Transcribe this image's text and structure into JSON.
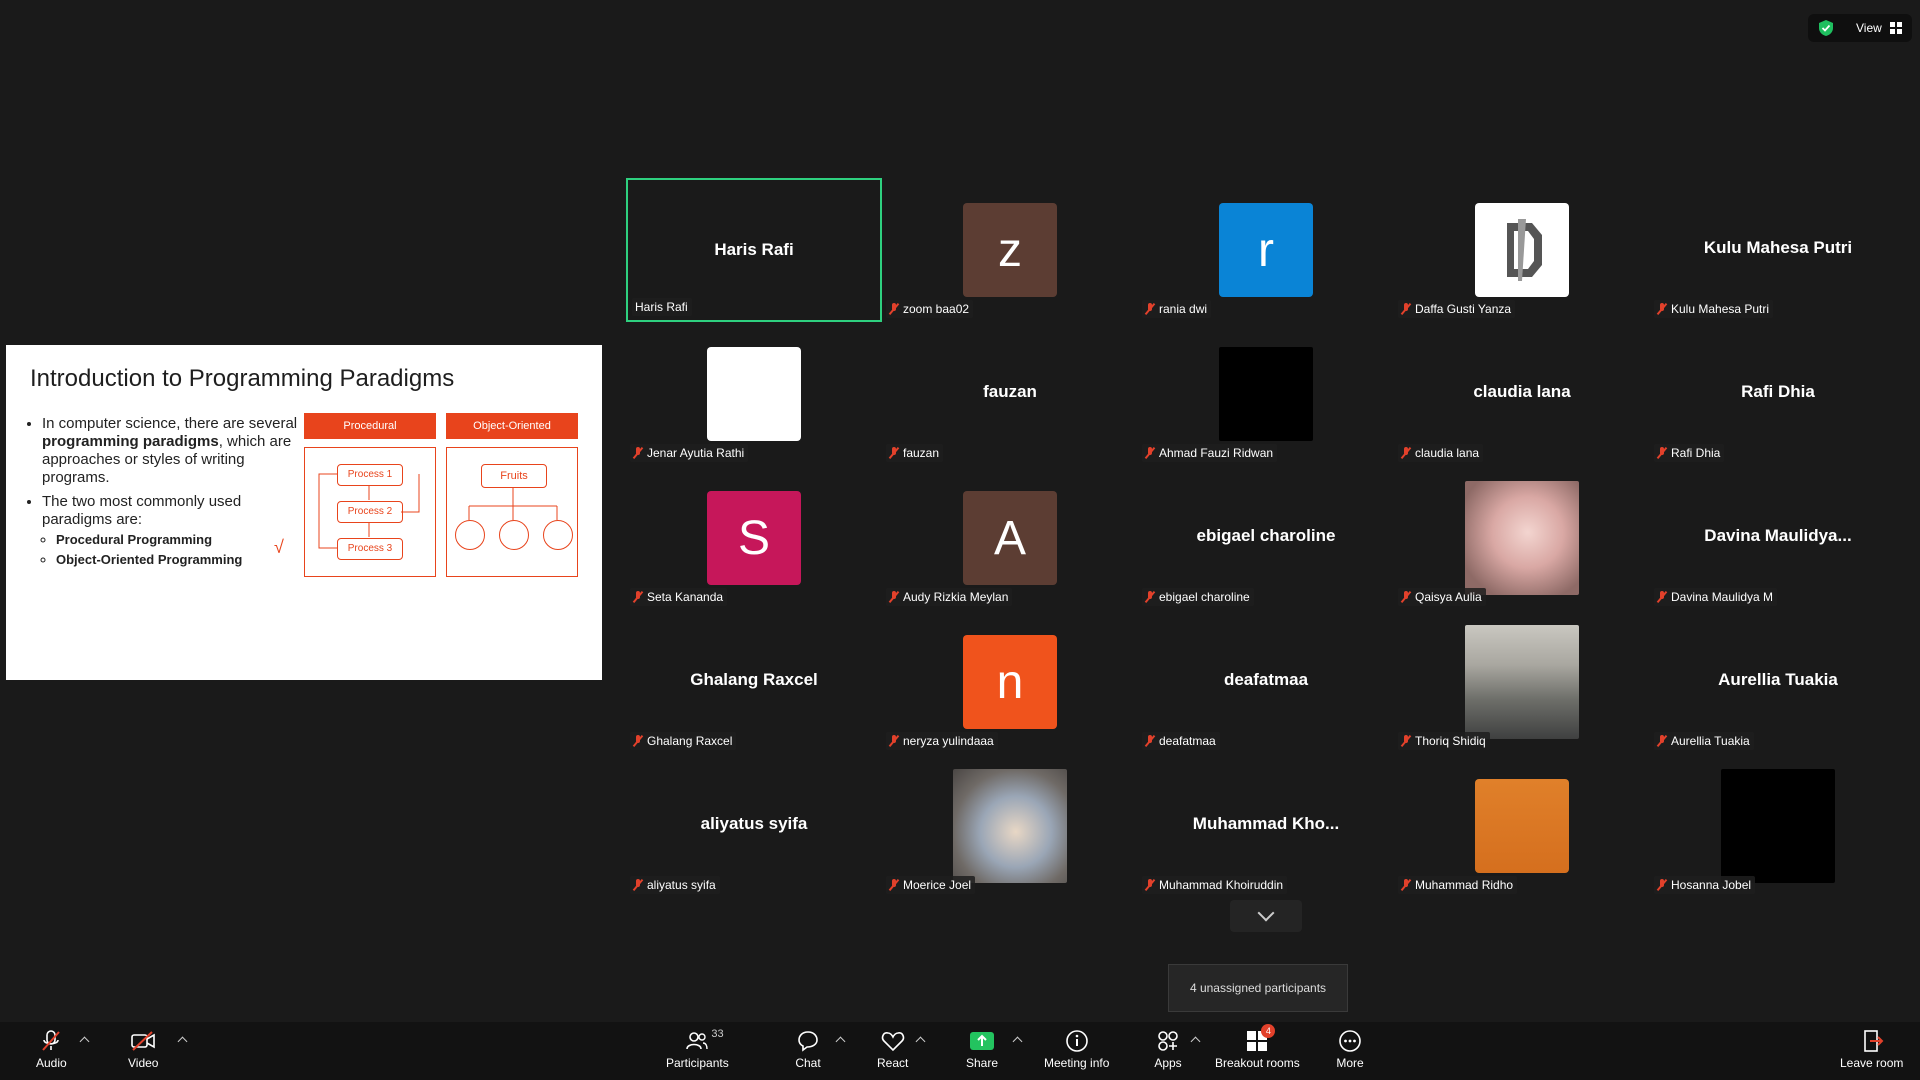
{
  "top_bar": {
    "view_label": "View",
    "shield_color": "#1fbf5f"
  },
  "slide": {
    "title": "Introduction to Programming Paradigms",
    "bullet1_pre": "In computer science, there are several ",
    "bullet1_bold": "programming paradigms",
    "bullet1_post": ", which are approaches or styles of writing programs.",
    "bullet2": "The two most commonly used paradigms are:",
    "sub1": "Procedural Programming",
    "sub2": "Object-Oriented Programming",
    "diagram_left_title": "Procedural",
    "diagram_right_title": "Object-Oriented",
    "process1": "Process 1",
    "process2": "Process 2",
    "process3": "Process 3",
    "fruits": "Fruits"
  },
  "participants": [
    {
      "name": "Haris Rafi",
      "display": "Haris Rafi",
      "type": "name",
      "active": true
    },
    {
      "name": "zoom baa02",
      "display": "z",
      "type": "avatar",
      "color": "#5c3d33"
    },
    {
      "name": "rania dwi",
      "display": "r",
      "type": "avatar",
      "color": "#0a84d6"
    },
    {
      "name": "Daffa Gusti Yanza",
      "display": "",
      "type": "logo"
    },
    {
      "name": "Kulu Mahesa Putri",
      "display": "Kulu Mahesa Putri",
      "type": "name"
    },
    {
      "name": "Jenar Ayutia Rathi",
      "display": "",
      "type": "photo-collage"
    },
    {
      "name": "fauzan",
      "display": "fauzan",
      "type": "name"
    },
    {
      "name": "Ahmad Fauzi Ridwan",
      "display": "",
      "type": "black"
    },
    {
      "name": "claudia lana",
      "display": "claudia lana",
      "type": "name"
    },
    {
      "name": "Rafi Dhia",
      "display": "Rafi Dhia",
      "type": "name"
    },
    {
      "name": "Seta Kananda",
      "display": "S",
      "type": "avatar",
      "color": "#c6175a"
    },
    {
      "name": "Audy Rizkia Meylan",
      "display": "A",
      "type": "avatar",
      "color": "#5c3d33"
    },
    {
      "name": "ebigael charoline",
      "display": "ebigael charoline",
      "type": "name"
    },
    {
      "name": "Qaisya Aulia",
      "display": "",
      "type": "photo-person"
    },
    {
      "name": "Davina Maulidya M",
      "display": "Davina  Maulidya...",
      "type": "name"
    },
    {
      "name": "Ghalang Raxcel",
      "display": "Ghalang Raxcel",
      "type": "name"
    },
    {
      "name": "neryza yulindaaa",
      "display": "n",
      "type": "avatar",
      "color": "#f0531c"
    },
    {
      "name": "deafatmaa",
      "display": "deafatmaa",
      "type": "name"
    },
    {
      "name": "Thoriq Shidiq",
      "display": "",
      "type": "photo-city"
    },
    {
      "name": "Aurellia Tuakia",
      "display": "Aurellia Tuakia",
      "type": "name"
    },
    {
      "name": "aliyatus syifa",
      "display": "aliyatus syifa",
      "type": "name"
    },
    {
      "name": "Moerice Joel",
      "display": "",
      "type": "photo-window"
    },
    {
      "name": "Muhammad Khoiruddin",
      "display": "Muhammad  Kho...",
      "type": "name"
    },
    {
      "name": "Muhammad Ridho",
      "display": "",
      "type": "photo-bart"
    },
    {
      "name": "Hosanna Jobel",
      "display": "",
      "type": "black"
    }
  ],
  "tooltip": "4 unassigned participants",
  "toolbar": {
    "audio": "Audio",
    "video": "Video",
    "participants": "Participants",
    "participants_count": "33",
    "chat": "Chat",
    "react": "React",
    "share": "Share",
    "meeting_info": "Meeting info",
    "apps": "Apps",
    "breakout_rooms": "Breakout rooms",
    "breakout_badge": "4",
    "more": "More",
    "leave": "Leave room"
  },
  "colors": {
    "active_border": "#2ed07f",
    "share_green": "#23c35f",
    "mute_red": "#e2412b"
  }
}
